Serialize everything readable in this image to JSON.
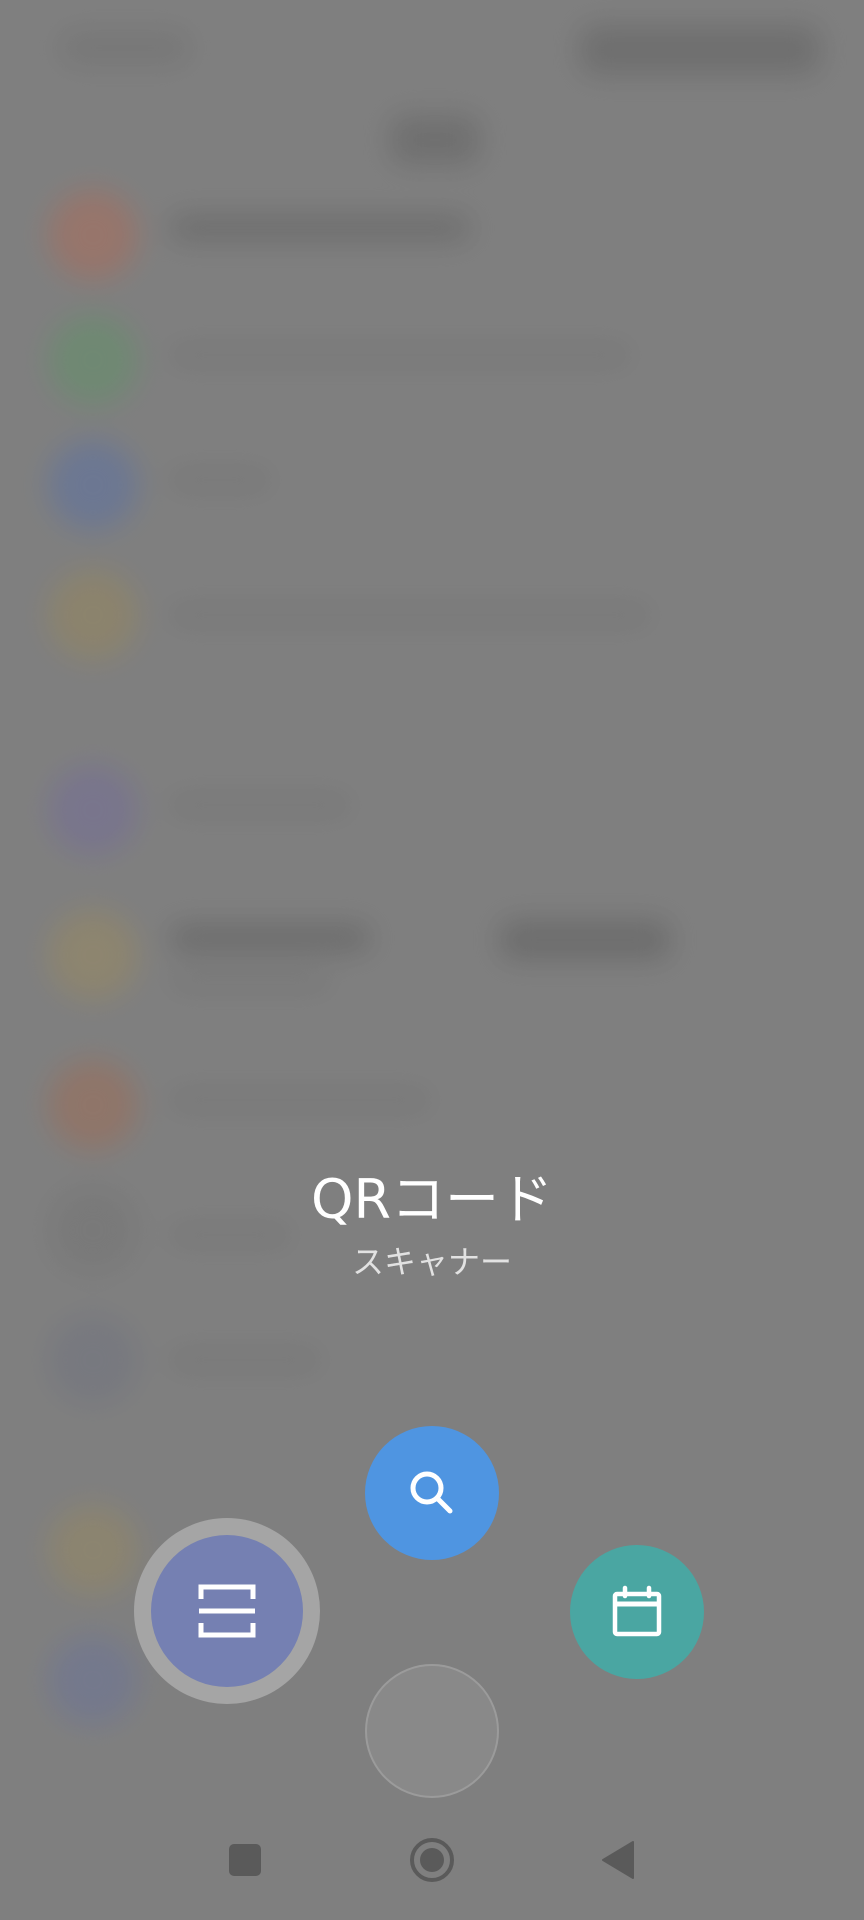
{
  "overlay": {
    "title": "QRコード",
    "subtitle": "スキャナー"
  },
  "fabs": {
    "qr_scanner": {
      "icon": "qr-scan-icon",
      "color": "#7580b2"
    },
    "search": {
      "icon": "search-icon",
      "color": "#4f95e1"
    },
    "calendar": {
      "icon": "calendar-icon",
      "color": "#4aa6a2"
    },
    "center": {
      "color": "#898989"
    }
  },
  "nav_bar": {
    "recents": {
      "icon": "square-icon"
    },
    "home": {
      "icon": "circle-home-icon"
    },
    "back": {
      "icon": "triangle-back-icon"
    }
  },
  "colors": {
    "scrim": "#858585"
  }
}
